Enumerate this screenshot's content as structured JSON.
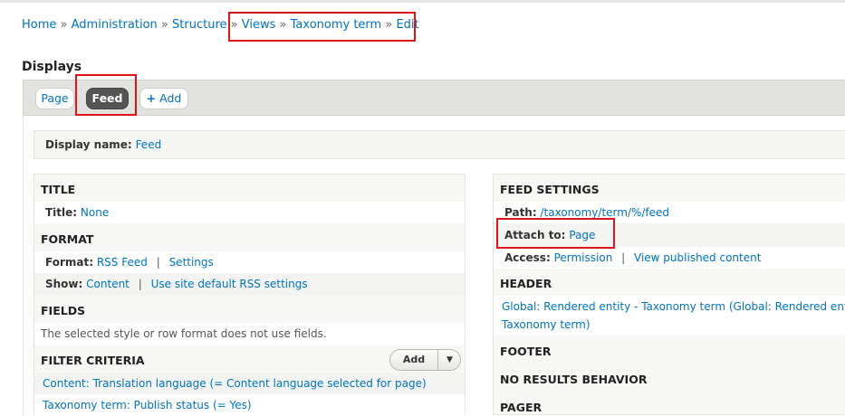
{
  "breadcrumb": {
    "home": "Home",
    "administration": "Administration",
    "structure": "Structure",
    "views": "Views",
    "taxonomy_term": "Taxonomy term",
    "edit": "Edit",
    "separator": "»"
  },
  "displays": {
    "title": "Displays",
    "tabs": {
      "page": "Page",
      "feed": "Feed",
      "add": "Add",
      "add_icon": "+"
    }
  },
  "display_name": {
    "label": "Display name:",
    "value": "Feed"
  },
  "left": {
    "title_section": {
      "heading": "TITLE",
      "label": "Title:",
      "value": "None"
    },
    "format_section": {
      "heading": "FORMAT",
      "format_label": "Format:",
      "format_value": "RSS Feed",
      "settings": "Settings",
      "show_label": "Show:",
      "show_value": "Content",
      "show_settings": "Use site default RSS settings"
    },
    "fields_section": {
      "heading": "FIELDS",
      "note": "The selected style or row format does not use fields."
    },
    "filter_section": {
      "heading": "FILTER CRITERIA",
      "add_button": "Add",
      "items": [
        "Content: Translation language (= Content language selected for page)",
        "Taxonomy term: Publish status (= Yes)"
      ]
    }
  },
  "right": {
    "feed_settings": {
      "heading": "FEED SETTINGS",
      "path_label": "Path:",
      "path_value": "/taxonomy/term/%/feed",
      "attach_label": "Attach to:",
      "attach_value": "Page",
      "access_label": "Access:",
      "access_value": "Permission",
      "access_extra": "View published content"
    },
    "header_section": {
      "heading": "HEADER",
      "item_line1": "Global: Rendered entity - Taxonomy term (Global: Rendered entit",
      "item_line2": "Taxonomy term)"
    },
    "footer_heading": "FOOTER",
    "no_results_heading": "NO RESULTS BEHAVIOR",
    "pager_heading": "PAGER"
  },
  "colors": {
    "link": "#0074bd",
    "highlight": "#e0131b",
    "active_tab": "#555555"
  }
}
